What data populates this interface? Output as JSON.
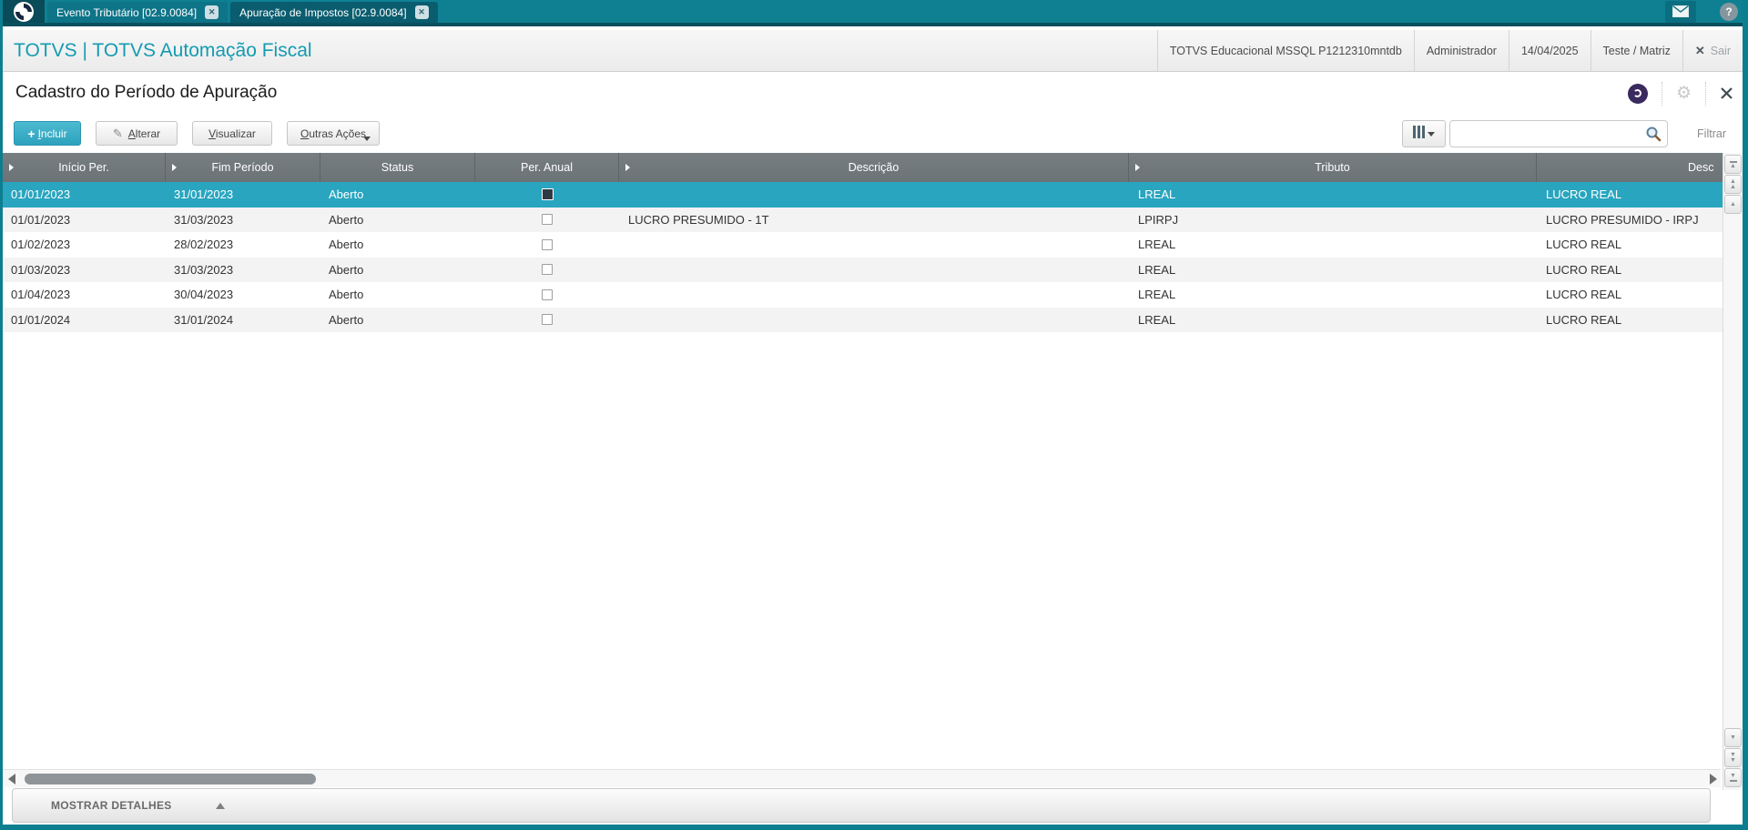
{
  "topbar": {
    "tabs": [
      {
        "label": "Evento Tributário [02.9.0084]",
        "active": false
      },
      {
        "label": "Apuração de Impostos [02.9.0084]",
        "active": true
      }
    ]
  },
  "header": {
    "brand": "TOTVS | TOTVS Automação Fiscal",
    "environment": "TOTVS Educacional MSSQL P1212310mntdb",
    "user": "Administrador",
    "date": "14/04/2025",
    "branch": "Teste / Matriz",
    "logout_label": "Sair"
  },
  "page": {
    "title": "Cadastro do Período de Apuração"
  },
  "toolbar": {
    "incluir_label": "Incluir",
    "alterar_label": "Alterar",
    "visualizar_label": "Visualizar",
    "outras_acoes_label": "Outras Ações",
    "filtrar_label": "Filtrar",
    "search_value": ""
  },
  "grid": {
    "columns": [
      {
        "label": "Início Per.",
        "arrow": true
      },
      {
        "label": "Fim Período",
        "arrow": true
      },
      {
        "label": "Status",
        "arrow": false
      },
      {
        "label": "Per. Anual",
        "arrow": false
      },
      {
        "label": "Descrição",
        "arrow": true
      },
      {
        "label": "Tributo",
        "arrow": true
      },
      {
        "label": "Desc",
        "arrow": false
      }
    ],
    "rows": [
      {
        "inicio": "01/01/2023",
        "fim": "31/01/2023",
        "status": "Aberto",
        "per_anual": false,
        "descricao": "",
        "tributo": "LREAL",
        "desc_tributo": "LUCRO REAL",
        "selected": true
      },
      {
        "inicio": "01/01/2023",
        "fim": "31/03/2023",
        "status": "Aberto",
        "per_anual": false,
        "descricao": "LUCRO PRESUMIDO - 1T",
        "tributo": "LPIRPJ",
        "desc_tributo": "LUCRO PRESUMIDO - IRPJ",
        "selected": false
      },
      {
        "inicio": "01/02/2023",
        "fim": "28/02/2023",
        "status": "Aberto",
        "per_anual": false,
        "descricao": "",
        "tributo": "LREAL",
        "desc_tributo": "LUCRO REAL",
        "selected": false
      },
      {
        "inicio": "01/03/2023",
        "fim": "31/03/2023",
        "status": "Aberto",
        "per_anual": false,
        "descricao": "",
        "tributo": "LREAL",
        "desc_tributo": "LUCRO REAL",
        "selected": false
      },
      {
        "inicio": "01/04/2023",
        "fim": "30/04/2023",
        "status": "Aberto",
        "per_anual": false,
        "descricao": "",
        "tributo": "LREAL",
        "desc_tributo": "LUCRO REAL",
        "selected": false
      },
      {
        "inicio": "01/01/2024",
        "fim": "31/01/2024",
        "status": "Aberto",
        "per_anual": false,
        "descricao": "",
        "tributo": "LREAL",
        "desc_tributo": "LUCRO REAL",
        "selected": false
      }
    ]
  },
  "footer": {
    "mostrar_detalhes_label": "MOSTRAR DETALHES"
  },
  "icons": {
    "totvs-logo": "circle-swirl",
    "mail": "envelope",
    "help": "?",
    "assistant": "purple-circle",
    "settings": "gear",
    "close": "x",
    "pencil": "✎",
    "columns": "|||",
    "magnifier": "lens",
    "sort": "right-triangle"
  },
  "colors": {
    "accent_teal": "#0d7e90",
    "topbar_teal": "#0e8092",
    "brand_text": "#149bb1",
    "selected_row": "#29a5bf",
    "grid_header": "#6b7377",
    "incluir_button": "#35a8c2",
    "row_stripe": "#f3f3f4"
  }
}
